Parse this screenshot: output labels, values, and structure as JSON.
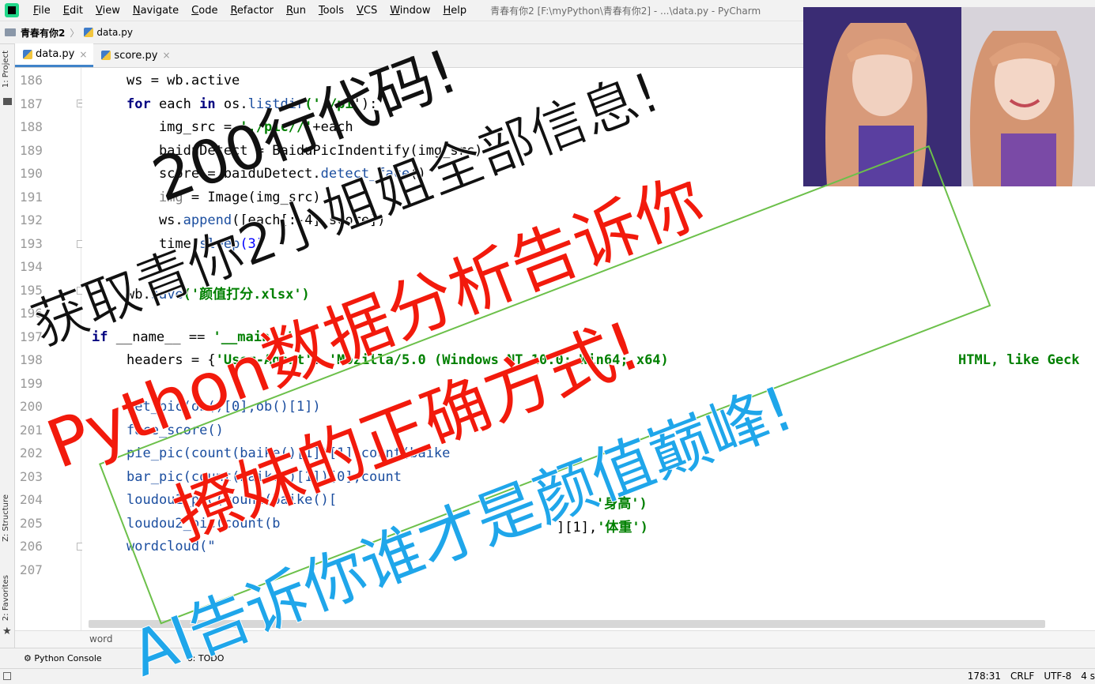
{
  "menubar": {
    "items": [
      "File",
      "Edit",
      "View",
      "Navigate",
      "Code",
      "Refactor",
      "Run",
      "Tools",
      "VCS",
      "Window",
      "Help"
    ],
    "title": "青春有你2 [F:\\myPython\\青春有你2] - ...\\data.py - PyCharm"
  },
  "navbar": {
    "project": "青春有你2",
    "file": "data.py"
  },
  "left_strip": {
    "project_tab": "1: Project",
    "structure_tab": "Z: Structure",
    "favorites_tab": "2: Favorites"
  },
  "tabs": [
    {
      "label": "data.py",
      "active": true
    },
    {
      "label": "score.py",
      "active": false
    }
  ],
  "gutter": {
    "lines": [
      "186",
      "187",
      "188",
      "189",
      "190",
      "191",
      "192",
      "193",
      "194",
      "195",
      "196",
      "197",
      "198",
      "199",
      "200",
      "201",
      "202",
      "203",
      "204",
      "205",
      "206",
      "207"
    ]
  },
  "code": {
    "l186": "ws = wb.active",
    "l187_a": "for",
    "l187_b": " each ",
    "l187_c": "in",
    "l187_d": " os.",
    "l187_e": "listdir",
    "l187_f": "('./pi",
    "l187_g": "'):",
    "l188_a": "    img_src = ",
    "l188_b": "'./pic//'",
    "l188_c": "+each",
    "l189": "    baiduDetect = BaiduPicIndentify(img_src)",
    "l190_a": "    score = baiduDetect.",
    "l190_b": "detect_face",
    "l190_c": "()",
    "l191_a": "    ",
    "l191_b": "img",
    "l191_c": " = Image(img_src)",
    "l192_a": "    ws.",
    "l192_b": "append",
    "l192_c": "([each[:-4],score])",
    "l193_a": "    time.",
    "l193_b": "sleep",
    "l193_c": "(3)",
    "l195_a": "wb.",
    "l195_b": "save",
    "l195_c": "('颜值打分.xlsx')",
    "l197_a": "if",
    "l197_b": " __name__ == ",
    "l197_c": "'__main__'",
    "l197_d": ":",
    "l198_a": "headers = {",
    "l198_b": "'User-Agent'",
    "l198_c": ": ",
    "l198_d": "'Mozilla/5.0 (Windows NT 10.0; Win64; x64)",
    "l198_e": "HTML, like Geck",
    "l200": "get_pic(ob()[0],ob()[1])",
    "l201": "face_score()",
    "l202": "pie_pic(count(baike()[1])[1],count(baike",
    "l203": "bar_pic(count(baike()[1])[0],count",
    "l204_a": "loudou1_pic(count(baike()[",
    "l204_b": "'身高')",
    "l205_a": "loudou2_pic(count(b",
    "l205_b": "][1],",
    "l205_c": "'体重')",
    "l206": "wordcloud(\""
  },
  "bottom_breadcrumb": "word",
  "toolwindows": {
    "python_console": "Python Console",
    "todo": "6: TODO"
  },
  "statusbar": {
    "position": "178:31",
    "line_sep": "CRLF",
    "encoding": "UTF-8",
    "indent": "4 s"
  },
  "overlays": {
    "headline_1": "200行代码!",
    "headline_2": "获取青你2小姐姐全部信息!",
    "red_1": "Python数据分析告诉你",
    "red_2": "撩妹的正确方式!",
    "blue_1": "AI告诉你谁才是颜值巅峰!"
  },
  "colors": {
    "red": "#f21a0c",
    "blue": "#1fa6ea",
    "green_border": "#6cc04a",
    "keyword": "#000080",
    "string": "#008000"
  }
}
